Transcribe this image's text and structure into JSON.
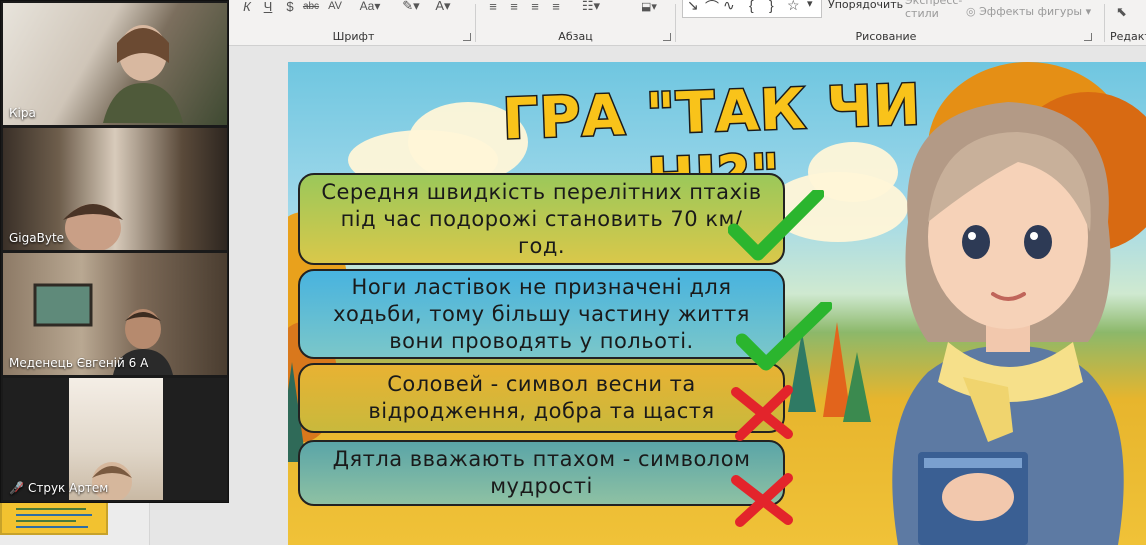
{
  "ribbon": {
    "groups": {
      "font": "Шрифт",
      "paragraph": "Абзац",
      "drawing": "Рисование",
      "editing": "Редакт"
    },
    "buttons": {
      "arrange": "Упорядочить",
      "quick_styles": "Экспресс-стили",
      "shape_effects": "Эффекты фигуры"
    }
  },
  "participants": [
    {
      "name": "Кіра",
      "active": true,
      "muted": false
    },
    {
      "name": "GigaByte",
      "active": false,
      "muted": false
    },
    {
      "name": "Меденець Євгеній 6 А",
      "active": false,
      "muted": false
    },
    {
      "name": "Струк Артем",
      "active": false,
      "muted": true
    }
  ],
  "slide": {
    "title": "ГРА \"ТАК ЧИ НІ?\"",
    "questions": [
      {
        "text": "Середня швидкість перелітних птахів під час подорожі становить 70 км/год.",
        "answer": "check"
      },
      {
        "text": "Ноги ластівок не призначені для ходьби, тому більшу частину життя вони проводять у польоті.",
        "answer": "check"
      },
      {
        "text": "Соловей - символ весни та відродження, добра та щастя",
        "answer": "cross"
      },
      {
        "text": "Дятла вважають птахом - символом мудрості",
        "answer": "cross"
      }
    ],
    "colors": {
      "title": "#f9c31a",
      "check": "#2bb52e",
      "cross": "#e3242b"
    }
  }
}
